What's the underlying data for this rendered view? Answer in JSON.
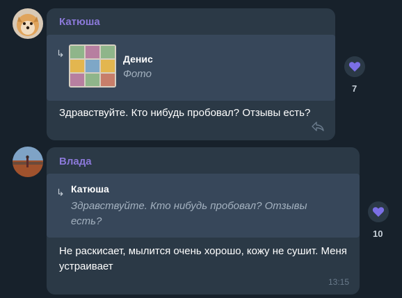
{
  "messages": [
    {
      "sender": "Катюша",
      "reply": {
        "name": "Денис",
        "text": "Фото"
      },
      "text": "Здравствуйте. Кто нибудь пробовал? Отзывы есть?",
      "reaction": {
        "icon": "heart-icon",
        "count": "7"
      }
    },
    {
      "sender": "Влада",
      "reply": {
        "name": "Катюша",
        "text": "Здравствуйте. Кто нибудь пробовал? Отзывы есть?"
      },
      "text": "Не раскисает, мылится очень хорошо, кожу не сушит. Меня устраивает",
      "time": "13:15",
      "reaction": {
        "icon": "heart-icon",
        "count": "10"
      }
    }
  ],
  "colors": {
    "background": "#17212b",
    "bubble": "#2b3946",
    "reply_box": "#37475a",
    "sender_name": "#8b79d9",
    "heart": "#7b6fe6"
  }
}
